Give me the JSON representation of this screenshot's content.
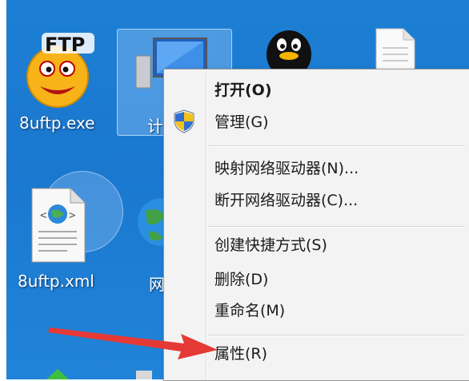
{
  "desktop": {
    "icons": [
      {
        "label": "8uftp.exe",
        "logo_text": "FTP"
      },
      {
        "label": "计"
      },
      {
        "label": ""
      },
      {
        "label": ""
      },
      {
        "label": "8uftp.xml"
      },
      {
        "label": "网"
      }
    ]
  },
  "context_menu": {
    "items": [
      {
        "label": "打开(O)",
        "bold": true
      },
      {
        "label": "管理(G)",
        "icon": "shield-icon"
      },
      {
        "label": "映射网络驱动器(N)..."
      },
      {
        "label": "断开网络驱动器(C)..."
      },
      {
        "label": "创建快捷方式(S)"
      },
      {
        "label": "删除(D)"
      },
      {
        "label": "重命名(M)"
      },
      {
        "label": "属性(R)"
      }
    ]
  },
  "colors": {
    "desktop_blue": "#1a78cf",
    "arrow_red": "#e53935",
    "menu_bg": "#f3f3f3"
  }
}
